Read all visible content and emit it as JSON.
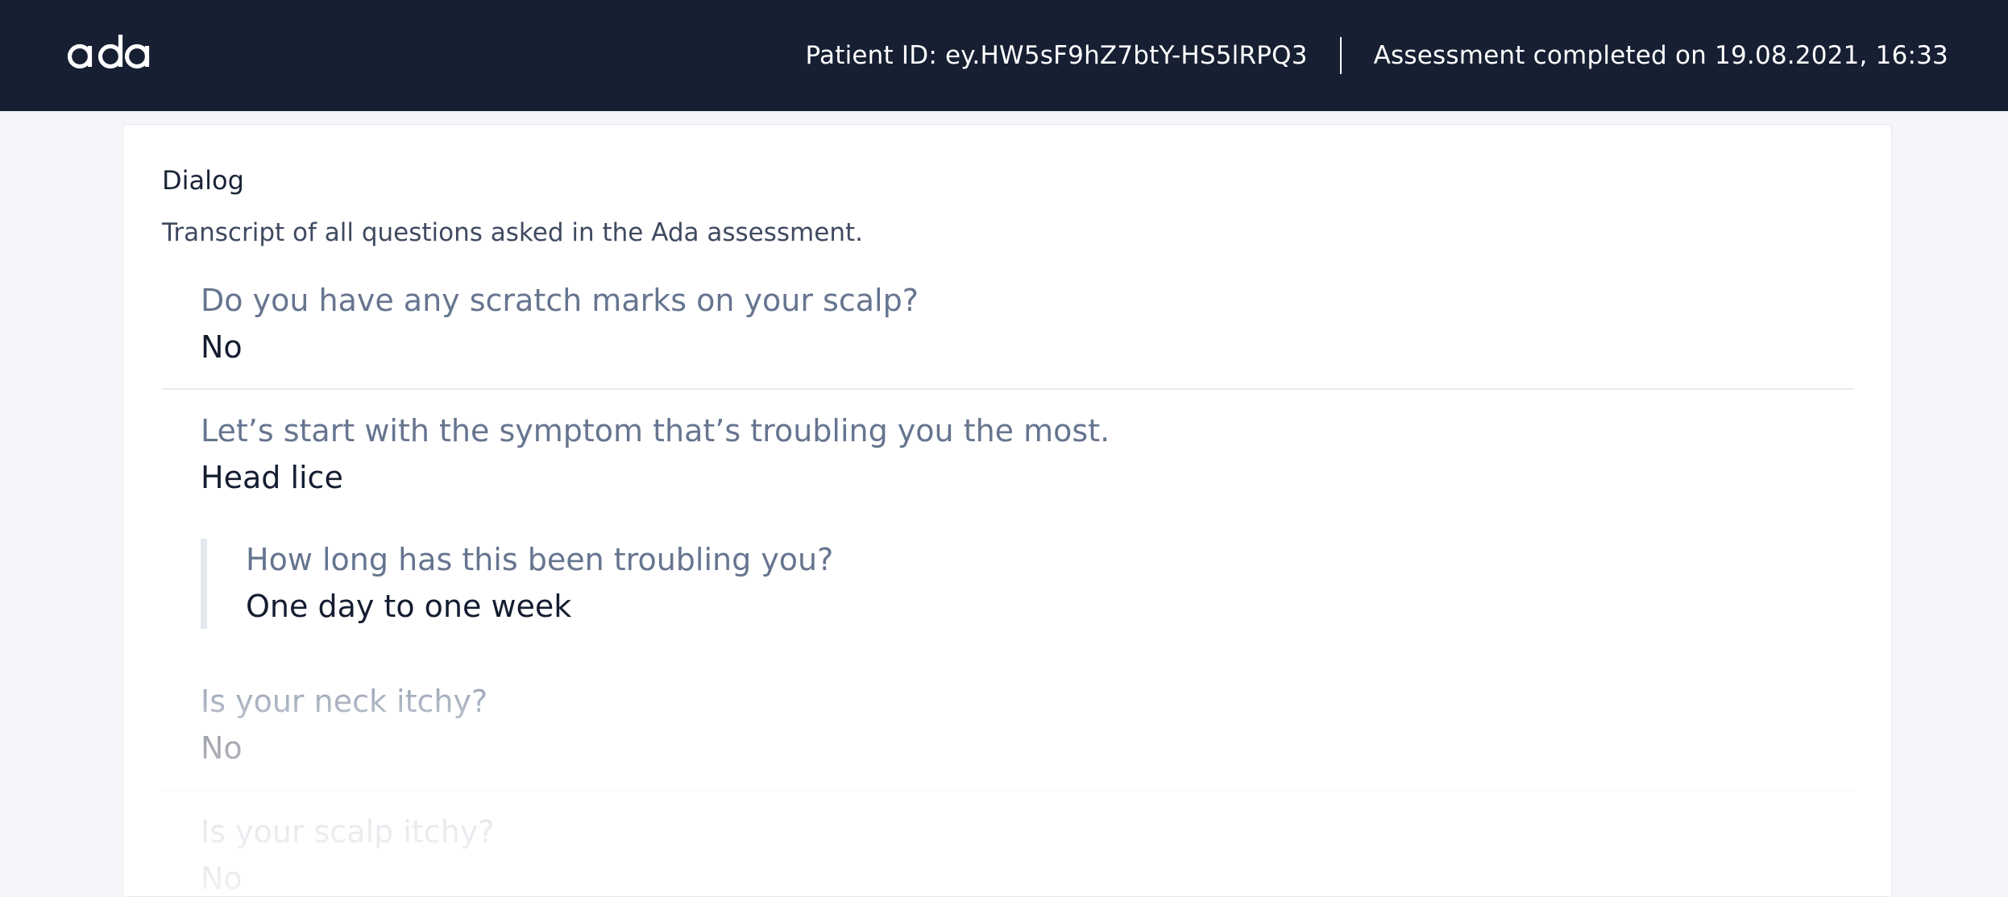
{
  "header": {
    "logo_text": "ada",
    "patient_id": "Patient ID: ey.HW5sF9hZ7btY-HS5lRPQ3",
    "assessment_completed": "Assessment completed on 19.08.2021, 16:33",
    "background_color": "#171f33"
  },
  "dialog": {
    "title": "Dialog",
    "description": "Transcript of all questions asked in the Ada assessment.",
    "items": [
      {
        "question": "Do you have any scratch marks on your scalp?",
        "answer": "No"
      },
      {
        "question": "Let’s start with the symptom that’s troubling you the most.",
        "answer": "Head lice"
      },
      {
        "question": "Is your neck itchy?",
        "answer": "No"
      },
      {
        "question": "Is your scalp itchy?",
        "answer": "No"
      }
    ],
    "sub_items": [
      {
        "question": "How long has this been troubling you?",
        "answer": "One day to one week"
      }
    ]
  }
}
